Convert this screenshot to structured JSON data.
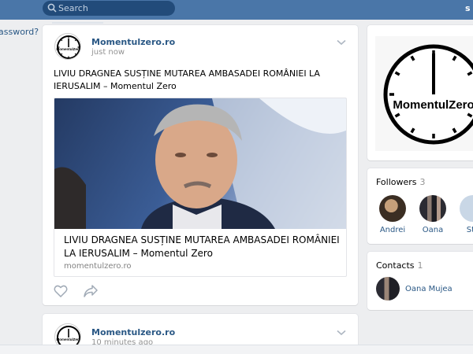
{
  "header": {
    "search_placeholder": "Search",
    "user_initial": "s"
  },
  "left": {
    "forgot_password_fragment": "assword?"
  },
  "posts": [
    {
      "author": "Momentulzero.ro",
      "time": "just now",
      "avatar_text": "MomentulZero",
      "text": "LIVIU DRAGNEA SUSȚINE MUTAREA AMBASADEI ROMÂNIEI LA IERUSALIM – Momentul Zero",
      "attachment": {
        "title": "LIVIU DRAGNEA SUSȚINE MUTAREA AMBASADEI ROMÂNIEI LA IERUSALIM – Momentul Zero",
        "site": "momentulzero.ro"
      }
    },
    {
      "author": "Momentulzero.ro",
      "time": "10 minutes ago",
      "avatar_text": "MomentulZero"
    }
  ],
  "sidebar": {
    "logo_text": "MomentulZero",
    "followers": {
      "title": "Followers",
      "count": "3",
      "people": [
        {
          "name": "Andrei"
        },
        {
          "name": "Oana"
        },
        {
          "name": "Ste"
        }
      ]
    },
    "contacts": {
      "title": "Contacts",
      "count": "1",
      "people": [
        {
          "name": "Oana Mujea"
        }
      ]
    }
  },
  "colors": {
    "header": "#4a76a8",
    "link": "#2a5885",
    "background": "#edeef0"
  }
}
